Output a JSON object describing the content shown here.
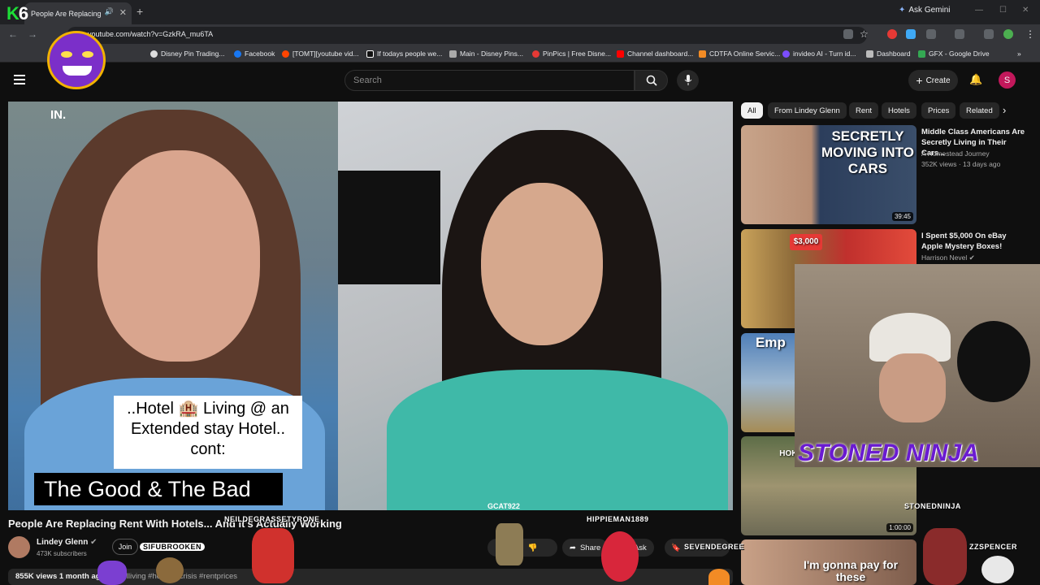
{
  "browser": {
    "tab_title": "People Are Replacing Rent",
    "url": "youtube.com/watch?v=GzkRA_mu6TA",
    "gemini_label": "Ask Gemini",
    "bookmarks": [
      "Disney Pin Trading...",
      "Facebook",
      "[TOMT][youtube vid...",
      "If todays people we...",
      "Main - Disney Pins...",
      "PinPics | Free Disne...",
      "Channel dashboard...",
      "CDTFA Online Servic...",
      "invideo AI - Turn id...",
      "Dashboard",
      "GFX - Google Drive"
    ]
  },
  "header": {
    "search_placeholder": "Search",
    "create_label": "Create",
    "avatar_letter": "S"
  },
  "chips": [
    "All",
    "From Lindey Glenn",
    "Rent",
    "Hotels",
    "Prices",
    "Related"
  ],
  "video": {
    "caption_box": "..Hotel 🏨 Living @ an Extended stay Hotel.. cont:",
    "caption_bottom": "The Good & The Bad",
    "badge": "IN.",
    "title": "People Are Replacing Rent With Hotels... And It's Actually Working",
    "channel": "Lindey Glenn",
    "subscribers": "473K subscribers",
    "join_label": "Join",
    "share_label": "Share",
    "ask_label": "Ask",
    "views": "855K views",
    "age": "1 month ago",
    "hashtags": "#hotelliving #housingcrisis #rentprices"
  },
  "recommendations": [
    {
      "title": "Middle Class Americans Are Secretly Living in Their Cars...",
      "channel": "A Homestead Journey",
      "meta": "352K views · 13 days ago",
      "duration": "39:45",
      "thumb_text": "SECRETLY MOVING INTO CARS"
    },
    {
      "title": "I Spent $5,000 On eBay Apple Mystery Boxes!",
      "channel": "Harrison Nevel",
      "meta": "",
      "duration": "",
      "thumb_text": "$3,000"
    },
    {
      "title": "",
      "channel": "",
      "meta": "",
      "duration": "",
      "thumb_text": "Emp"
    },
    {
      "title": "",
      "channel": "",
      "meta": "",
      "duration": "1:00:00",
      "thumb_text": "HOKA"
    },
    {
      "title": "",
      "channel": "",
      "meta": "",
      "duration": "",
      "thumb_text": "I'm gonna pay for these"
    }
  ],
  "overlay": {
    "logo_k": "K",
    "logo_num": "6",
    "stoned_ninja": "STONED NINJA",
    "stoned_ninja_tag": "STONEDNINJA",
    "usernames": [
      "GCAT922",
      "NEILDEGRASSETYRONE",
      "HIPPIEMAN1889",
      "SIFUBROOKEN",
      "SEVENDEGREE",
      "ZZSPENCER"
    ]
  },
  "colors": {
    "accent_red": "#ff0000",
    "overlay_green": "#1dde37",
    "overlay_purple": "#6a1bd1"
  }
}
